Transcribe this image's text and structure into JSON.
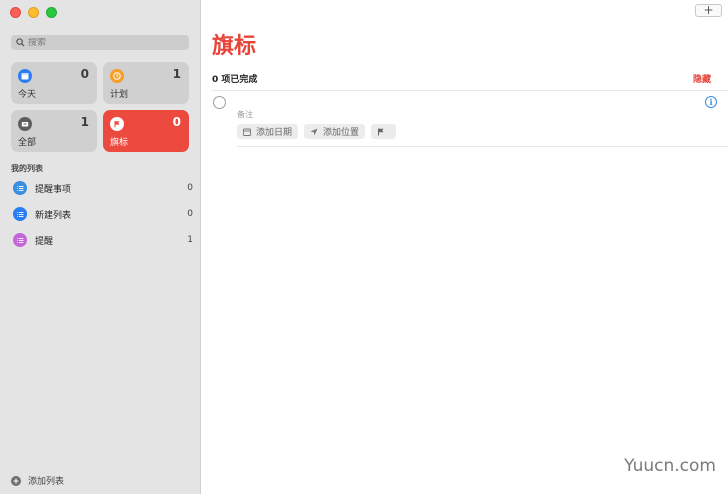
{
  "sidebar": {
    "search": {
      "placeholder": "搜索"
    },
    "smart_lists": [
      {
        "label": "今天",
        "count": "0",
        "icon": "calendar-icon",
        "color": "#2a7ef5"
      },
      {
        "label": "计划",
        "count": "1",
        "icon": "clock-icon",
        "color": "#f59e2a"
      },
      {
        "label": "全部",
        "count": "1",
        "icon": "tray-icon",
        "color": "#5e5e5e"
      },
      {
        "label": "旗标",
        "count": "0",
        "icon": "flag-icon",
        "color": "#ec4a3f"
      }
    ],
    "section_title": "我的列表",
    "lists": [
      {
        "name": "提醒事项",
        "count": "0",
        "color": "#3b8de0"
      },
      {
        "name": "新建列表",
        "count": "0",
        "color": "#2a7ef5"
      },
      {
        "name": "提醒",
        "count": "1",
        "color": "#c266d9"
      }
    ],
    "add_list_label": "添加列表"
  },
  "main": {
    "add_button": "+",
    "title": "旗标",
    "completed_text": "0 项已完成",
    "hide_label": "隐藏",
    "task": {
      "notes_placeholder": "备注",
      "add_date_label": "添加日期",
      "add_location_label": "添加位置"
    }
  },
  "watermark": "Yuucn.com",
  "colors": {
    "accent_red": "#e8453a",
    "info_blue": "#3b8de0"
  }
}
